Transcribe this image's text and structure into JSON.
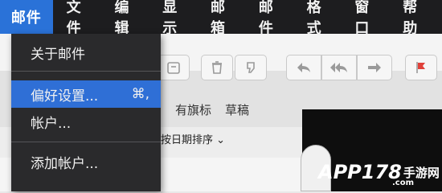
{
  "menubar": {
    "items": [
      "邮件",
      "文件",
      "编辑",
      "显示",
      "邮箱",
      "邮件",
      "格式",
      "窗口",
      "帮助"
    ],
    "active_index": 0
  },
  "dropdown": {
    "about": "关于邮件",
    "preferences": "偏好设置...",
    "preferences_shortcut": "⌘,",
    "accounts": "帐户...",
    "add_account": "添加帐户..."
  },
  "favorites": {
    "flagged": "有旗标",
    "drafts": "草稿"
  },
  "list": {
    "sort_label": "按日期排序 ⌄"
  },
  "watermark": {
    "brand": "APP178",
    "cn": "手游网",
    "domain": ".com"
  },
  "colors": {
    "menubar_bg": "#1d1d1f",
    "accent": "#2f6fd6",
    "dropdown_bg": "#2a2a2c",
    "flag": "#e0413a"
  },
  "icons": [
    "compose-icon",
    "trash-icon",
    "junk-icon",
    "reply-icon",
    "reply-all-icon",
    "forward-icon",
    "flag-icon",
    "chevron-down-icon"
  ]
}
